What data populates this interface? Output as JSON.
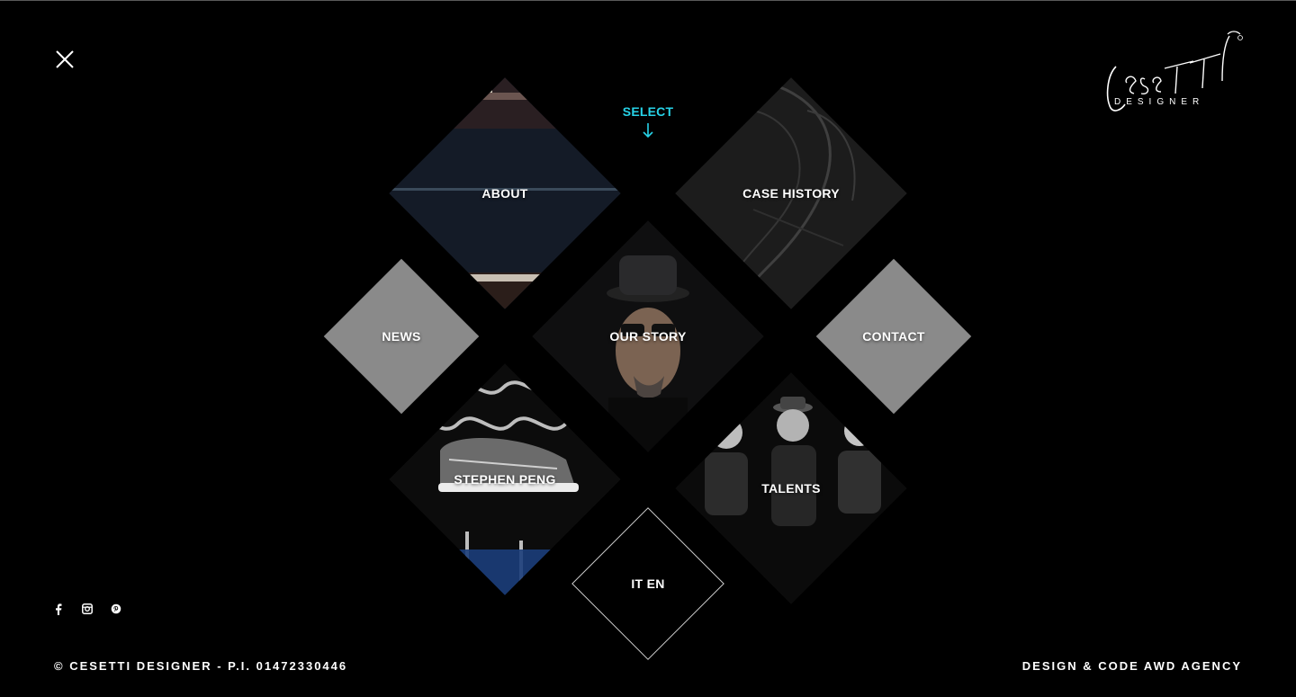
{
  "menu": {
    "select_label": "SELECT",
    "tiles": {
      "about": "ABOUT",
      "case_history": "CASE HISTORY",
      "news": "NEWS",
      "our_story": "OUR STORY",
      "contact": "CONTACT",
      "stephen_peng": "STEPHEN PENG",
      "talents": "TALENTS",
      "language": "IT EN"
    }
  },
  "logo": {
    "brand": "Cesetti",
    "sub": "DESIGNER"
  },
  "footer": {
    "copyright": "© CESETTI DESIGNER - P.I. 01472330446",
    "credit": "DESIGN & CODE AWD AGENCY"
  },
  "social": {
    "icons": [
      "facebook-icon",
      "instagram-icon",
      "pinterest-icon"
    ]
  },
  "colors": {
    "background": "#000000",
    "accent": "#27d3e8",
    "tile_gray": "#8a8a8a"
  }
}
